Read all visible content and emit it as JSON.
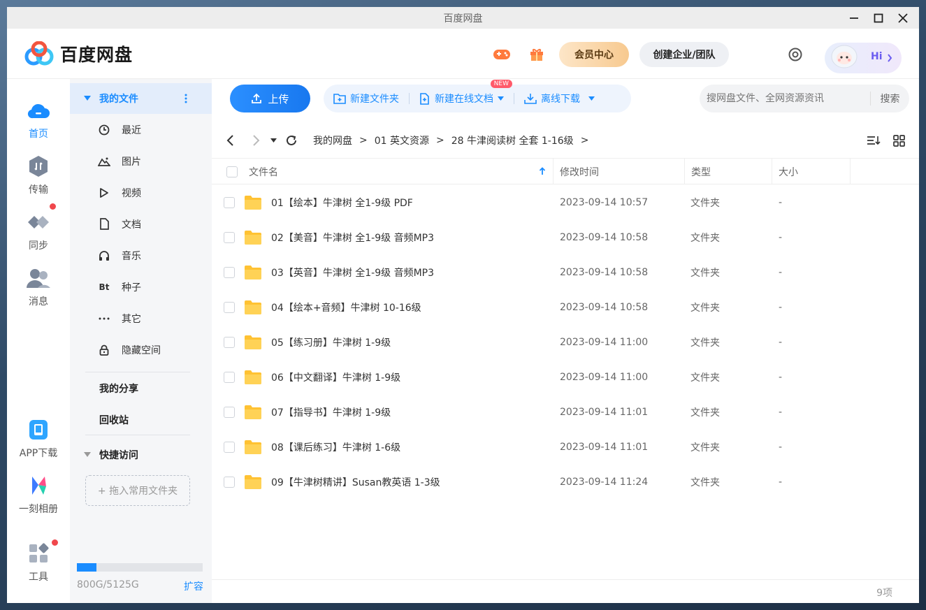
{
  "window": {
    "title": "百度网盘"
  },
  "header": {
    "logo_text": "百度网盘",
    "vip_label": "会员中心",
    "team_label": "创建企业/团队",
    "greeting": "Hi"
  },
  "rail": {
    "items": [
      {
        "label": "首页",
        "icon": "cloud-home-icon"
      },
      {
        "label": "传输",
        "icon": "transfer-icon"
      },
      {
        "label": "同步",
        "icon": "sync-icon"
      },
      {
        "label": "消息",
        "icon": "message-icon"
      },
      {
        "label": "APP下载",
        "icon": "app-download-icon"
      },
      {
        "label": "一刻相册",
        "icon": "album-icon"
      },
      {
        "label": "工具",
        "icon": "tools-icon"
      }
    ]
  },
  "sidebar": {
    "my_files": "我的文件",
    "items": [
      {
        "label": "最近",
        "icon": "clock-icon"
      },
      {
        "label": "图片",
        "icon": "image-icon"
      },
      {
        "label": "视频",
        "icon": "video-icon"
      },
      {
        "label": "文档",
        "icon": "document-icon"
      },
      {
        "label": "音乐",
        "icon": "headphones-icon"
      },
      {
        "label": "种子",
        "icon": "bt-icon"
      },
      {
        "label": "其它",
        "icon": "more-icon"
      },
      {
        "label": "隐藏空间",
        "icon": "lock-icon"
      }
    ],
    "my_share": "我的分享",
    "recycle": "回收站",
    "quick_access": "快捷访问",
    "drop_hint": "+ 拖入常用文件夹",
    "quota_text": "800G/5125G",
    "quota_fraction": 0.156,
    "expand_label": "扩容"
  },
  "toolbar": {
    "upload": "上传",
    "new_folder": "新建文件夹",
    "new_doc": "新建在线文档",
    "new_badge": "NEW",
    "offline": "离线下载",
    "search_placeholder": "搜网盘文件、全网资源资讯",
    "search_button": "搜索"
  },
  "breadcrumb": [
    "我的网盘",
    "01 英文资源",
    "28 牛津阅读树 全套 1-16级"
  ],
  "table": {
    "headers": {
      "name": "文件名",
      "modified": "修改时间",
      "type": "类型",
      "size": "大小"
    },
    "rows": [
      {
        "name": "01【绘本】牛津树 全1-9级 PDF",
        "modified": "2023-09-14 10:57",
        "type": "文件夹",
        "size": "-"
      },
      {
        "name": "02【美音】牛津树 全1-9级 音频MP3",
        "modified": "2023-09-14 10:58",
        "type": "文件夹",
        "size": "-"
      },
      {
        "name": "03【英音】牛津树 全1-9级 音频MP3",
        "modified": "2023-09-14 10:58",
        "type": "文件夹",
        "size": "-"
      },
      {
        "name": "04【绘本+音频】牛津树 10-16级",
        "modified": "2023-09-14 10:58",
        "type": "文件夹",
        "size": "-"
      },
      {
        "name": "05【练习册】牛津树 1-9级",
        "modified": "2023-09-14 11:00",
        "type": "文件夹",
        "size": "-"
      },
      {
        "name": "06【中文翻译】牛津树 1-9级",
        "modified": "2023-09-14 11:00",
        "type": "文件夹",
        "size": "-"
      },
      {
        "name": "07【指导书】牛津树 1-9级",
        "modified": "2023-09-14 11:01",
        "type": "文件夹",
        "size": "-"
      },
      {
        "name": "08【课后练习】牛津树 1-6级",
        "modified": "2023-09-14 11:01",
        "type": "文件夹",
        "size": "-"
      },
      {
        "name": "09【牛津树精讲】Susan教英语 1-3级",
        "modified": "2023-09-14 11:24",
        "type": "文件夹",
        "size": "-"
      }
    ]
  },
  "footer": {
    "count": "9项"
  },
  "colors": {
    "accent": "#1a8cff",
    "folder": "#ffc233",
    "badge": "#f0474c"
  }
}
